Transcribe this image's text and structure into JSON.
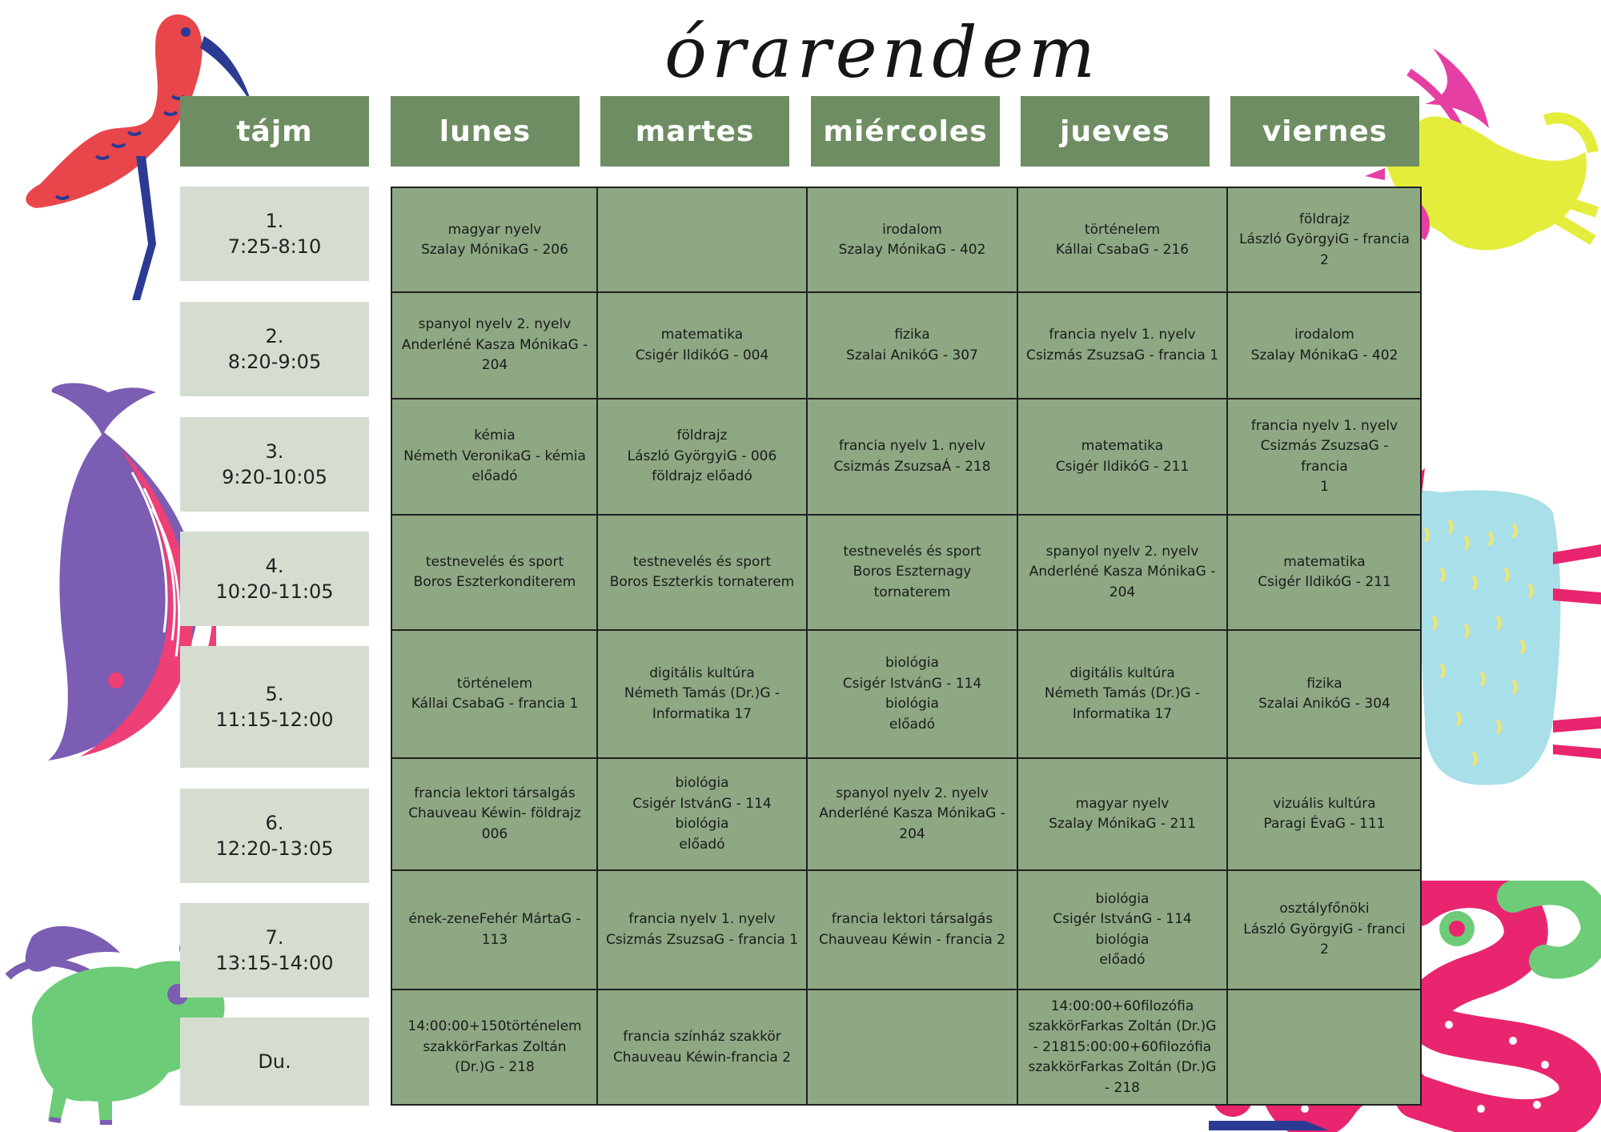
{
  "title": "órarendem",
  "header": {
    "time_label": "tájm",
    "days": [
      "lunes",
      "martes",
      "miércoles",
      "jueves",
      "viernes"
    ]
  },
  "periods": [
    {
      "num": "1.",
      "time": "7:25-8:10"
    },
    {
      "num": "2.",
      "time": "8:20-9:05"
    },
    {
      "num": "3.",
      "time": "9:20-10:05"
    },
    {
      "num": "4.",
      "time": "10:20-11:05"
    },
    {
      "num": "5.",
      "time": "11:15-12:00"
    },
    {
      "num": "6.",
      "time": "12:20-13:05"
    },
    {
      "num": "7.",
      "time": "13:15-14:00"
    },
    {
      "num": "Du.",
      "time": ""
    }
  ],
  "rows": [
    [
      "magyar nyelv\nSzalay MónikaG - 206",
      "",
      "irodalom\nSzalay MónikaG - 402",
      "történelem\nKállai CsabaG - 216",
      "földrajz\nLászló GyörgyiG - francia\n2"
    ],
    [
      "spanyol nyelv 2. nyelv\nAnderléné Kasza MónikaG -\n204",
      "matematika\nCsigér IldikóG - 004",
      "fizika\nSzalai AnikóG - 307",
      "francia nyelv 1. nyelv\nCsizmás ZsuzsaG - francia 1",
      "irodalom\nSzalay MónikaG - 402"
    ],
    [
      "kémia\nNémeth VeronikaG - kémia\nelőadó",
      "földrajz\nLászló GyörgyiG - 006\nföldrajz előadó",
      "francia nyelv 1. nyelv\nCsizmás ZsuzsaÁ - 218",
      "matematika\nCsigér IldikóG - 211",
      "francia nyelv 1. nyelv\nCsizmás ZsuzsaG - francia\n1"
    ],
    [
      "testnevelés és sport\nBoros Eszterkonditerem",
      "testnevelés és sport\nBoros Eszterkis tornaterem",
      "testnevelés és sport\nBoros Eszternagy\ntornaterem",
      "spanyol nyelv 2. nyelv\nAnderléné Kasza MónikaG -\n204",
      "matematika\nCsigér IldikóG - 211"
    ],
    [
      "történelem\nKállai CsabaG - francia 1",
      "digitális kultúra\nNémeth Tamás (Dr.)G -\nInformatika 17",
      "biológia\nCsigér IstvánG - 114 biológia\nelőadó",
      "digitális kultúra\nNémeth Tamás (Dr.)G -\nInformatika 17",
      "fizika\nSzalai AnikóG - 304"
    ],
    [
      "francia lektori társalgás\nChauveau Kéwin- földrajz\n006",
      "biológia\nCsigér IstvánG - 114 biológia\nelőadó",
      "spanyol nyelv 2. nyelv\nAnderléné Kasza MónikaG -\n204",
      "magyar nyelv\nSzalay MónikaG - 211",
      "vizuális kultúra\nParagi ÉvaG - 111"
    ],
    [
      "ének-zeneFehér MártaG -\n113",
      "francia nyelv 1. nyelv\nCsizmás ZsuzsaG - francia 1",
      "francia lektori társalgás\nChauveau Kéwin - francia 2",
      "biológia\nCsigér IstvánG - 114 biológia\nelőadó",
      "osztályfőnöki\nLászló GyörgyiG - franci\n2"
    ],
    [
      "14:00:00+150történelem\nszakkörFarkas Zoltán\n(Dr.)G - 218",
      "francia színház szakkör\nChauveau Kéwin-francia 2",
      "",
      "14:00:00+60filozófia\nszakkörFarkas Zoltán (Dr.)G\n- 21815:00:00+60filozófia\nszakkörFarkas Zoltán (Dr.)G\n- 218",
      ""
    ]
  ],
  "icons": [
    "ibis-icon",
    "whale-icon",
    "pig-icon",
    "rooster-icon",
    "llama-icon",
    "snake-icon"
  ],
  "colors": {
    "header_green": "#6f8d62",
    "cell_green": "#8da883",
    "time_bg": "#d5ddd1"
  }
}
